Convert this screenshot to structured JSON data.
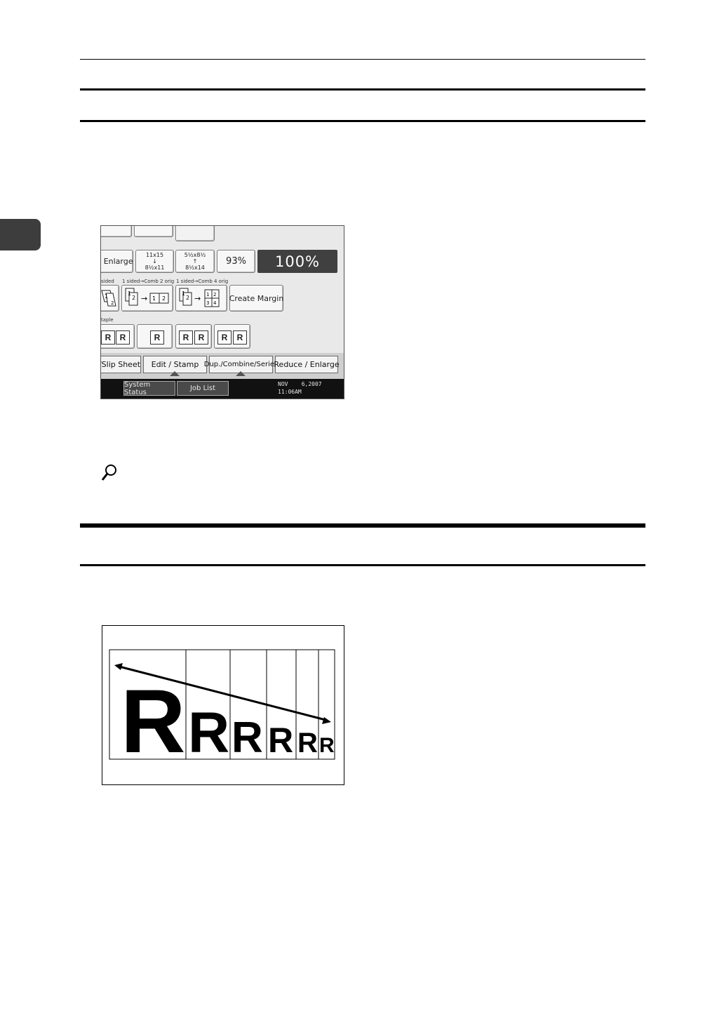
{
  "panel": {
    "ratio_buttons": [
      {
        "top": "11x15",
        "bottom": "8½x11"
      },
      {
        "top": "5½x8½",
        "bottom": "8½x14"
      }
    ],
    "reduce_enlarge_label": "/ Enlarge",
    "preset_percent": "93%",
    "selected_percent": "100%",
    "duplex_caption": "sided",
    "comb2_caption": "1 sided→Comb 2 orig",
    "comb4_caption": "1 sided→Comb 4 orig",
    "create_margin_label": "Create Margin",
    "staple_caption": "taple",
    "tabs": {
      "slip_sheet": "/Slip Sheet",
      "edit_stamp": "Edit / Stamp",
      "dup_combine_series": "Dup./Combine/Series",
      "reduce_enlarge": "Reduce / Enlarge"
    },
    "system_status": "System Status",
    "job_list": "Job List",
    "date": "NOV    6,2007",
    "time": "11:06AM"
  },
  "diagram": {
    "letters": [
      "R",
      "R",
      "R",
      "R",
      "R",
      "R"
    ]
  },
  "icons": [
    "magnifier-icon",
    "double-arrow-icon",
    "r-orientation-icon",
    "page-combine-icon"
  ]
}
